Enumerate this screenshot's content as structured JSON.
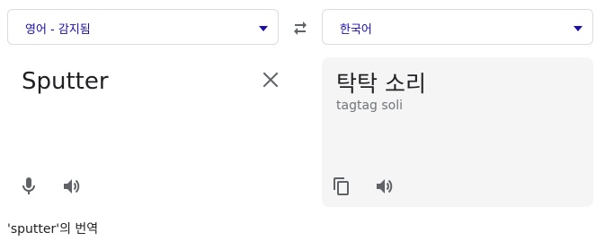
{
  "source": {
    "language": "영어 - 감지됨",
    "text": "Sputter"
  },
  "target": {
    "language": "한국어",
    "text": "탁탁 소리",
    "transliteration": "tagtag soli"
  },
  "footer": {
    "translation_of": "'sputter'의 번역"
  },
  "icons": {
    "swap": "swap-arrows-icon",
    "clear": "close-icon",
    "mic": "microphone-icon",
    "speaker": "speaker-icon",
    "copy": "copy-icon"
  },
  "colors": {
    "accent": "#1a0dab",
    "icon": "#5f6368",
    "target_panel_bg": "#f5f5f5"
  }
}
